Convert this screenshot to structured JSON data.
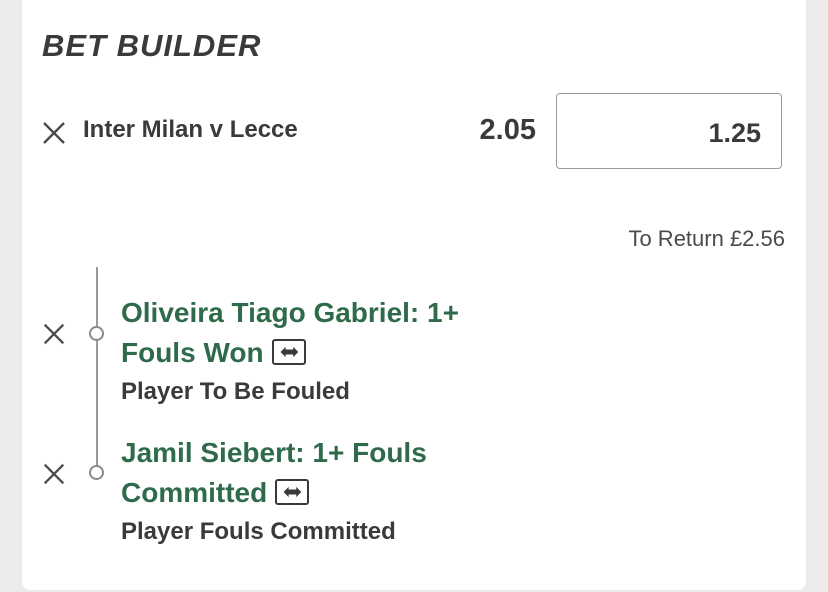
{
  "bet_builder": {
    "title": "BET BUILDER",
    "match": "Inter Milan v Lecce",
    "odds": "2.05",
    "stake_value": "1.25",
    "to_return": "To Return £2.56",
    "selections": [
      {
        "title_line1": "Oliveira Tiago Gabriel: 1+",
        "title_line2": "Fouls Won",
        "market": "Player To Be Fouled"
      },
      {
        "title_line1": "Jamil Siebert: 1+ Fouls",
        "title_line2": "Committed",
        "market": "Player Fouls Committed"
      }
    ]
  },
  "icons": {
    "remove": "close-icon",
    "swap": "swap-icon"
  },
  "colors": {
    "selection_green": "#2f6b4b",
    "text_dark": "#3a3a3a"
  }
}
